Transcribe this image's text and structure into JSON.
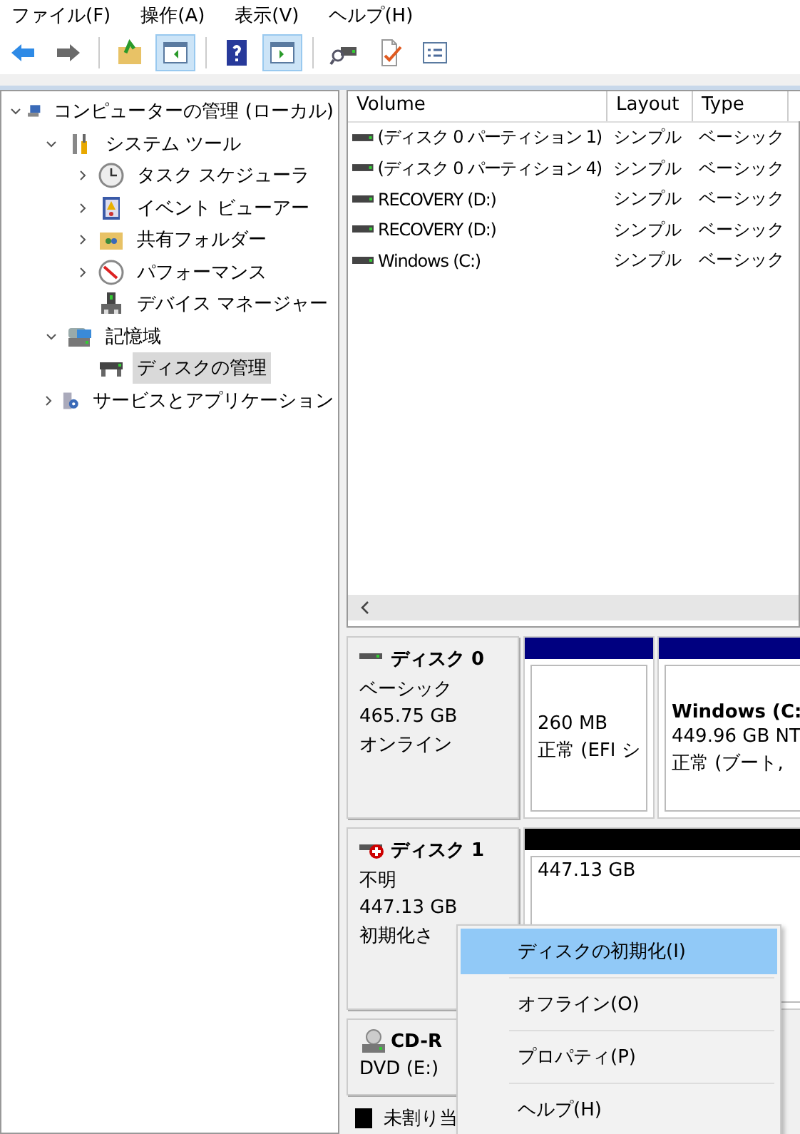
{
  "menu": [
    "ファイル(F)",
    "操作(A)",
    "表示(V)",
    "ヘルプ(H)"
  ],
  "toolbar": [
    [
      {
        "kind": "back"
      },
      {
        "kind": "forward"
      }
    ],
    [
      {
        "kind": "up"
      },
      {
        "kind": "panel-left",
        "pressed": true
      }
    ],
    [
      {
        "kind": "help"
      },
      {
        "kind": "panel-right",
        "pressed": true
      }
    ],
    [
      {
        "kind": "drive"
      },
      {
        "kind": "check"
      },
      {
        "kind": "list"
      }
    ]
  ],
  "tree": [
    {
      "label": "コンピューターの管理 (ローカル)",
      "kind": "computer",
      "expanded": true,
      "selected": false,
      "children": [
        {
          "label": "システム ツール",
          "kind": "tools",
          "expanded": true,
          "selected": false,
          "children": [
            {
              "label": "タスク スケジューラ",
              "kind": "clock",
              "expanded": false,
              "selected": false
            },
            {
              "label": "イベント ビューアー",
              "kind": "book",
              "expanded": false,
              "selected": false
            },
            {
              "label": "共有フォルダー",
              "kind": "folder",
              "expanded": false,
              "selected": false
            },
            {
              "label": "パフォーマンス",
              "kind": "gauge",
              "expanded": false,
              "selected": false
            },
            {
              "label": "デバイス マネージャー",
              "kind": "device",
              "selected": false
            }
          ]
        },
        {
          "label": "記憶域",
          "kind": "storage",
          "expanded": true,
          "selected": false,
          "children": [
            {
              "label": "ディスクの管理",
              "kind": "drive",
              "selected": true
            }
          ]
        },
        {
          "label": "サービスとアプリケーション",
          "kind": "services",
          "expanded": false,
          "selected": false
        }
      ]
    }
  ],
  "table": {
    "columns": [
      "Volume",
      "Layout",
      "Type"
    ],
    "rows": [
      {
        "volume": "(ディスク 0 パーティション 1)",
        "layout": "シンプル",
        "type": "ベーシック"
      },
      {
        "volume": "(ディスク 0 パーティション 4)",
        "layout": "シンプル",
        "type": "ベーシック"
      },
      {
        "volume": "RECOVERY (D:)",
        "layout": "シンプル",
        "type": "ベーシック"
      },
      {
        "volume": "RECOVERY (D:)",
        "layout": "シンプル",
        "type": "ベーシック"
      },
      {
        "volume": "Windows (C:)",
        "layout": "シンプル",
        "type": "ベーシック"
      }
    ]
  },
  "disks": [
    {
      "kind": "online",
      "name": "ディスク 0",
      "lines": [
        "ベーシック",
        "465.75 GB",
        "オンライン"
      ],
      "partitions": [
        {
          "color": "#000080",
          "lines": [
            "260 MB",
            "正常 (EFI シ"
          ]
        },
        {
          "color": "#000080",
          "title": "Windows  (C:",
          "lines": [
            "449.96 GB NT",
            "正常 (ブート,"
          ]
        }
      ]
    },
    {
      "kind": "unknown",
      "name": "ディスク 1",
      "lines": [
        "不明",
        "447.13 GB",
        "初期化さ"
      ],
      "partitions": [
        {
          "color": "#000000",
          "lines": [
            "447.13 GB"
          ]
        }
      ]
    },
    {
      "kind": "cdrom",
      "name": "CD-R",
      "lines": [
        "DVD (E:)"
      ]
    }
  ],
  "legend": [
    {
      "label": "未割り当",
      "color": "#000000"
    }
  ],
  "context_menu": [
    {
      "label": "ディスクの初期化(I)",
      "selected": true
    },
    {
      "label": "オフライン(O)",
      "selected": false
    },
    {
      "label": "プロパティ(P)",
      "selected": false
    },
    {
      "label": "ヘルプ(H)",
      "selected": false
    }
  ]
}
